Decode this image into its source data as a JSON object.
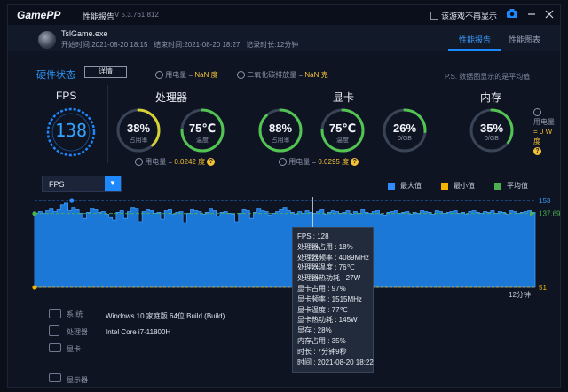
{
  "titlebar": {
    "logo": "GamePP",
    "title": "性能报告",
    "version": "V 5.3.761.812",
    "no_show_label": "该游戏不再显示"
  },
  "session": {
    "exe": "TslGame.exe",
    "start_label": "开始时间:",
    "start": "2021-08-20 18:15",
    "end_label": "结束时间:",
    "end": "2021-08-20 18:27",
    "duration_label": "记录时长:",
    "duration": "12分钟"
  },
  "tabs": [
    {
      "label": "性能报告",
      "active": true
    },
    {
      "label": "性能图表",
      "active": false
    }
  ],
  "hardware": {
    "title": "硬件状态",
    "detail_button": "详情",
    "power_note_label": "用电量 =",
    "power_note_value": "NaN 度",
    "co2_note_label": "二氧化碳排放量 =",
    "co2_note_value": "NaN 克",
    "ps_note": "P.S. 数据图显示的是平均值"
  },
  "fps": {
    "title": "FPS",
    "value": "138"
  },
  "cpu": {
    "title": "处理器",
    "usage": {
      "value": "38%",
      "label": "占用率",
      "fraction": 0.38
    },
    "temp": {
      "value": "75℃",
      "label": "温度",
      "fraction": 0.75
    },
    "power_label": "用电量 =",
    "power_value": "0.0242 度"
  },
  "gpu": {
    "title": "显卡",
    "usage": {
      "value": "88%",
      "label": "占用率",
      "fraction": 0.88
    },
    "temp": {
      "value": "75℃",
      "label": "温度",
      "fraction": 0.75
    },
    "vram": {
      "value": "26%",
      "label": "0/GB",
      "fraction": 0.26
    },
    "power_label": "用电量 =",
    "power_value": "0.0295 度"
  },
  "memory": {
    "title": "内存",
    "usage": {
      "value": "35%",
      "label": "0/GB",
      "fraction": 0.35
    },
    "power_label": "用电量",
    "power_value": "= 0 W",
    "power_unit": "度"
  },
  "chart_controls": {
    "selected_metric": "FPS",
    "legend": [
      {
        "label": "最大值",
        "color": "#2f8cff"
      },
      {
        "label": "最小值",
        "color": "#f4b400"
      },
      {
        "label": "平均值",
        "color": "#4caf50"
      }
    ]
  },
  "chart_data": {
    "type": "area",
    "metric": "FPS",
    "x_end_label": "12分钟",
    "max_value": 153,
    "min_value": 51,
    "avg_value": 137.69,
    "ylim": [
      51,
      153
    ],
    "values": [
      138,
      140,
      138,
      141,
      143,
      140,
      142,
      148,
      150,
      141,
      145,
      142,
      138,
      132,
      139,
      144,
      142,
      139,
      140,
      137,
      133,
      130,
      139,
      141,
      132,
      140,
      145,
      143,
      128,
      140,
      142,
      141,
      138,
      139,
      131,
      141,
      142,
      137,
      139,
      140,
      127,
      138,
      142,
      141,
      140,
      137,
      139,
      143,
      141,
      135,
      139,
      140,
      138,
      137,
      128,
      138,
      142,
      141,
      132,
      139,
      143,
      141,
      140,
      136,
      138,
      140,
      142,
      145,
      141,
      139,
      137,
      140,
      138,
      141,
      139,
      138,
      140,
      142,
      137,
      139,
      141,
      140,
      138,
      139,
      141,
      137,
      140,
      138,
      142,
      139,
      138,
      140,
      141,
      137,
      136,
      139,
      140,
      141,
      138,
      139,
      140,
      137,
      139,
      138,
      141,
      140,
      139,
      137,
      141,
      140,
      138,
      139,
      140,
      141,
      138,
      139,
      137,
      140,
      141,
      139,
      138,
      140,
      139,
      141,
      138,
      140,
      139,
      137,
      141,
      140,
      138,
      139,
      140,
      141,
      139,
      138
    ],
    "cursor_index": 75
  },
  "tooltip": {
    "rows": [
      "FPS : 128",
      "处理器占用 : 18%",
      "处理器频率 : 4089MHz",
      "处理器温度 : 76℃",
      "处理器热功耗 : 27W",
      "显卡占用 : 97%",
      "显卡频率 : 1515MHz",
      "显卡温度 : 77℃",
      "显卡热功耗 : 145W",
      "显存 : 28%",
      "内存占用 : 35%",
      "时长 : 7分钟9秒",
      "时间 : 2021-08-20 18:22"
    ]
  },
  "system": {
    "os_label": "系 统",
    "os_value": "Windows 10 家庭版 64位   Build (Build)",
    "cpu_label": "处理器",
    "cpu_value": "Intel Core i7-11800H",
    "gpu_label": "显卡",
    "display_label": "显示器"
  },
  "colors": {
    "accent": "#1e88ff",
    "gauge_track": "#3a4457",
    "gauge_yellow": "#d4d036",
    "gauge_green": "#52c452",
    "chart_fill": "#1b78d6",
    "avg_line": "#4caf50"
  }
}
